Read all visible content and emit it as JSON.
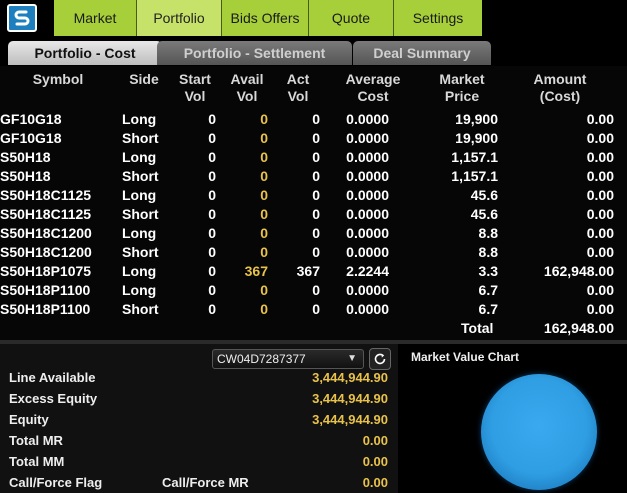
{
  "nav": {
    "items": [
      {
        "label": "Market"
      },
      {
        "label": "Portfolio"
      },
      {
        "label": "Bids Offers"
      },
      {
        "label": "Quote"
      },
      {
        "label": "Settings"
      }
    ],
    "active_index": 1
  },
  "subtabs": [
    {
      "label": "Portfolio - Cost",
      "active": true
    },
    {
      "label": "Portfolio - Settlement",
      "active": false
    },
    {
      "label": "Deal Summary",
      "active": false
    }
  ],
  "table": {
    "headers": {
      "symbol": "Symbol",
      "side": "Side",
      "start_vol": [
        "Start",
        "Vol"
      ],
      "avail_vol": [
        "Avail",
        "Vol"
      ],
      "act_vol": [
        "Act",
        "Vol"
      ],
      "average_cost": [
        "Average",
        "Cost"
      ],
      "market_price": [
        "Market",
        "Price"
      ],
      "amount_cost": [
        "Amount",
        "(Cost)"
      ]
    },
    "rows": [
      {
        "symbol": "GF10G18",
        "side": "Long",
        "start": "0",
        "avail": "0",
        "act": "0",
        "avg": "0.0000",
        "mkt": "19,900",
        "amt": "0.00"
      },
      {
        "symbol": "GF10G18",
        "side": "Short",
        "start": "0",
        "avail": "0",
        "act": "0",
        "avg": "0.0000",
        "mkt": "19,900",
        "amt": "0.00"
      },
      {
        "symbol": "S50H18",
        "side": "Long",
        "start": "0",
        "avail": "0",
        "act": "0",
        "avg": "0.0000",
        "mkt": "1,157.1",
        "amt": "0.00"
      },
      {
        "symbol": "S50H18",
        "side": "Short",
        "start": "0",
        "avail": "0",
        "act": "0",
        "avg": "0.0000",
        "mkt": "1,157.1",
        "amt": "0.00"
      },
      {
        "symbol": "S50H18C1125",
        "side": "Long",
        "start": "0",
        "avail": "0",
        "act": "0",
        "avg": "0.0000",
        "mkt": "45.6",
        "amt": "0.00"
      },
      {
        "symbol": "S50H18C1125",
        "side": "Short",
        "start": "0",
        "avail": "0",
        "act": "0",
        "avg": "0.0000",
        "mkt": "45.6",
        "amt": "0.00"
      },
      {
        "symbol": "S50H18C1200",
        "side": "Long",
        "start": "0",
        "avail": "0",
        "act": "0",
        "avg": "0.0000",
        "mkt": "8.8",
        "amt": "0.00"
      },
      {
        "symbol": "S50H18C1200",
        "side": "Short",
        "start": "0",
        "avail": "0",
        "act": "0",
        "avg": "0.0000",
        "mkt": "8.8",
        "amt": "0.00"
      },
      {
        "symbol": "S50H18P1075",
        "side": "Long",
        "start": "0",
        "avail": "367",
        "act": "367",
        "avg": "2.2244",
        "mkt": "3.3",
        "amt": "162,948.00"
      },
      {
        "symbol": "S50H18P1100",
        "side": "Long",
        "start": "0",
        "avail": "0",
        "act": "0",
        "avg": "0.0000",
        "mkt": "6.7",
        "amt": "0.00"
      },
      {
        "symbol": "S50H18P1100",
        "side": "Short",
        "start": "0",
        "avail": "0",
        "act": "0",
        "avg": "0.0000",
        "mkt": "6.7",
        "amt": "0.00"
      }
    ],
    "total_label": "Total",
    "total_value": "162,948.00"
  },
  "account": {
    "selected": "CW04D7287377"
  },
  "financials": [
    {
      "label": "Line Available",
      "label2": "",
      "value": "3,444,944.90"
    },
    {
      "label": "Excess Equity",
      "label2": "",
      "value": "3,444,944.90"
    },
    {
      "label": "Equity",
      "label2": "",
      "value": "3,444,944.90"
    },
    {
      "label": "Total MR",
      "label2": "",
      "value": "0.00"
    },
    {
      "label": "Total MM",
      "label2": "",
      "value": "0.00"
    },
    {
      "label": "Call/Force Flag",
      "label2": "Call/Force MR",
      "value": "0.00"
    }
  ],
  "chart": {
    "title": "Market Value Chart",
    "color": "#2f9ee3"
  },
  "colors": {
    "nav_bg": "#a7cf3a",
    "nav_active": "#c7e268",
    "accent_value": "#e8c24a",
    "logo_bg": "#1e7fbf"
  },
  "icons": {
    "logo": "app-logo-icon",
    "dropdown": "chevron-down-icon",
    "refresh": "refresh-icon"
  }
}
